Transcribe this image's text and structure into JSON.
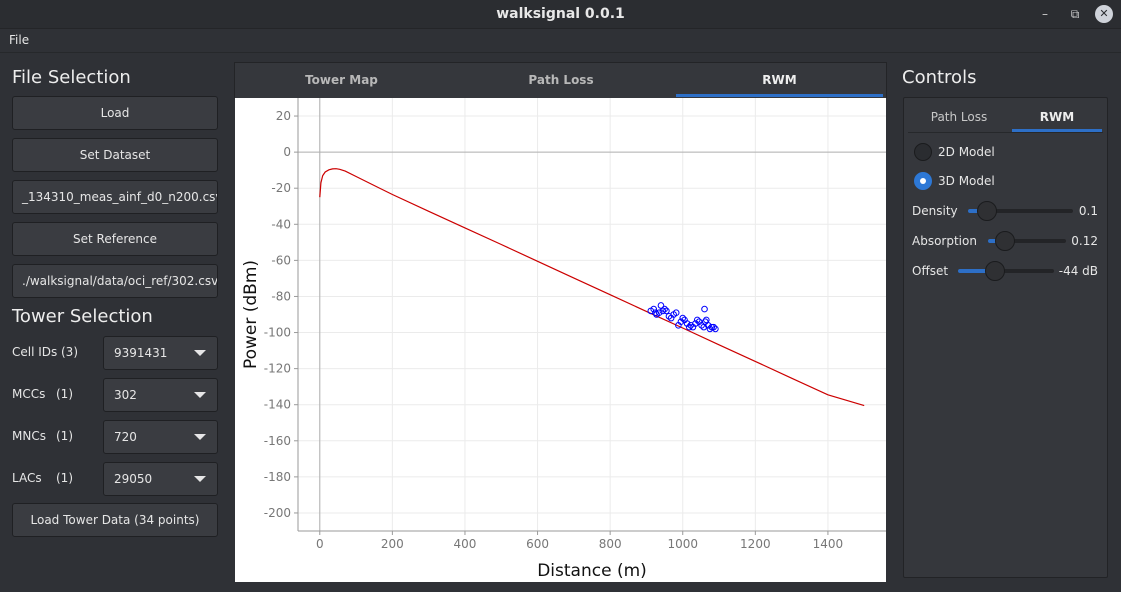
{
  "window": {
    "title": "walksignal 0.0.1"
  },
  "menu": {
    "file": "File"
  },
  "file_selection": {
    "title": "File Selection",
    "load": "Load",
    "set_dataset": "Set Dataset",
    "dataset_path": "_134310_meas_ainf_d0_n200.csv",
    "set_reference": "Set Reference",
    "reference_path": "./walksignal/data/oci_ref/302.csv"
  },
  "tower_selection": {
    "title": "Tower Selection",
    "cell_ids": {
      "label": "Cell IDs",
      "count": "(3)",
      "value": "9391431"
    },
    "mccs": {
      "label": "MCCs",
      "count": "(1)",
      "value": "302"
    },
    "mncs": {
      "label": "MNCs",
      "count": "(1)",
      "value": "720"
    },
    "lacs": {
      "label": "LACs",
      "count": "(1)",
      "value": "29050"
    },
    "load_button": "Load Tower Data (34 points)"
  },
  "main_tabs": {
    "tower_map": "Tower Map",
    "path_loss": "Path Loss",
    "rwm": "RWM",
    "active": "RWM"
  },
  "controls": {
    "title": "Controls",
    "tabs": {
      "path_loss": "Path Loss",
      "rwm": "RWM"
    },
    "model_2d": "2D Model",
    "model_3d": "3D Model",
    "density": {
      "label": "Density",
      "value": "0.1",
      "position": 0.1
    },
    "absorption": {
      "label": "Absorption",
      "value": "0.12",
      "position": 0.12
    },
    "offset": {
      "label": "Offset",
      "value": "-44 dB",
      "position": 0.35
    }
  },
  "colors": {
    "accent": "#2d6fc7",
    "model_line": "#cc0000",
    "measured_points": "#0000ff"
  },
  "chart_data": {
    "type": "line",
    "xlabel": "Distance (m)",
    "ylabel": "Power (dBm)",
    "xlim": [
      -60,
      1560
    ],
    "ylim": [
      -210,
      30
    ],
    "xticks": [
      0,
      200,
      400,
      600,
      800,
      1000,
      1200,
      1400
    ],
    "yticks": [
      20,
      0,
      -20,
      -40,
      -60,
      -80,
      -100,
      -120,
      -140,
      -160,
      -180,
      -200
    ],
    "grid": true,
    "series": [
      {
        "kind": "line",
        "x": [
          0,
          3,
          8,
          15,
          25,
          35,
          45,
          55,
          70,
          100,
          150,
          200,
          300,
          400,
          500,
          600,
          700,
          800,
          900,
          1000,
          1100,
          1200,
          1300,
          1400,
          1500
        ],
        "y": [
          -25,
          -17,
          -13,
          -11,
          -9.8,
          -9.3,
          -9.2,
          -9.5,
          -10.5,
          -13.5,
          -18.5,
          -23.5,
          -32.8,
          -42,
          -51.2,
          -60.5,
          -69.8,
          -79,
          -88.3,
          -97.5,
          -106.8,
          -116,
          -125.3,
          -134.5,
          -140.5
        ]
      },
      {
        "kind": "scatter",
        "x": [
          912,
          920,
          928,
          935,
          940,
          945,
          950,
          955,
          962,
          968,
          975,
          982,
          988,
          995,
          1000,
          1005,
          1012,
          1018,
          1022,
          1028,
          1035,
          1040,
          1045,
          1052,
          1058,
          1062,
          1065,
          1070,
          1075,
          1080,
          1085,
          1090,
          925,
          1060
        ],
        "y": [
          -88,
          -87,
          -90,
          -89,
          -85,
          -88,
          -87,
          -88,
          -91,
          -92,
          -90,
          -89,
          -96,
          -94,
          -92,
          -93,
          -95,
          -97,
          -96,
          -97,
          -95,
          -93,
          -94,
          -96,
          -97,
          -94,
          -93,
          -96,
          -98,
          -97,
          -97,
          -98,
          -89,
          -87
        ]
      }
    ]
  }
}
